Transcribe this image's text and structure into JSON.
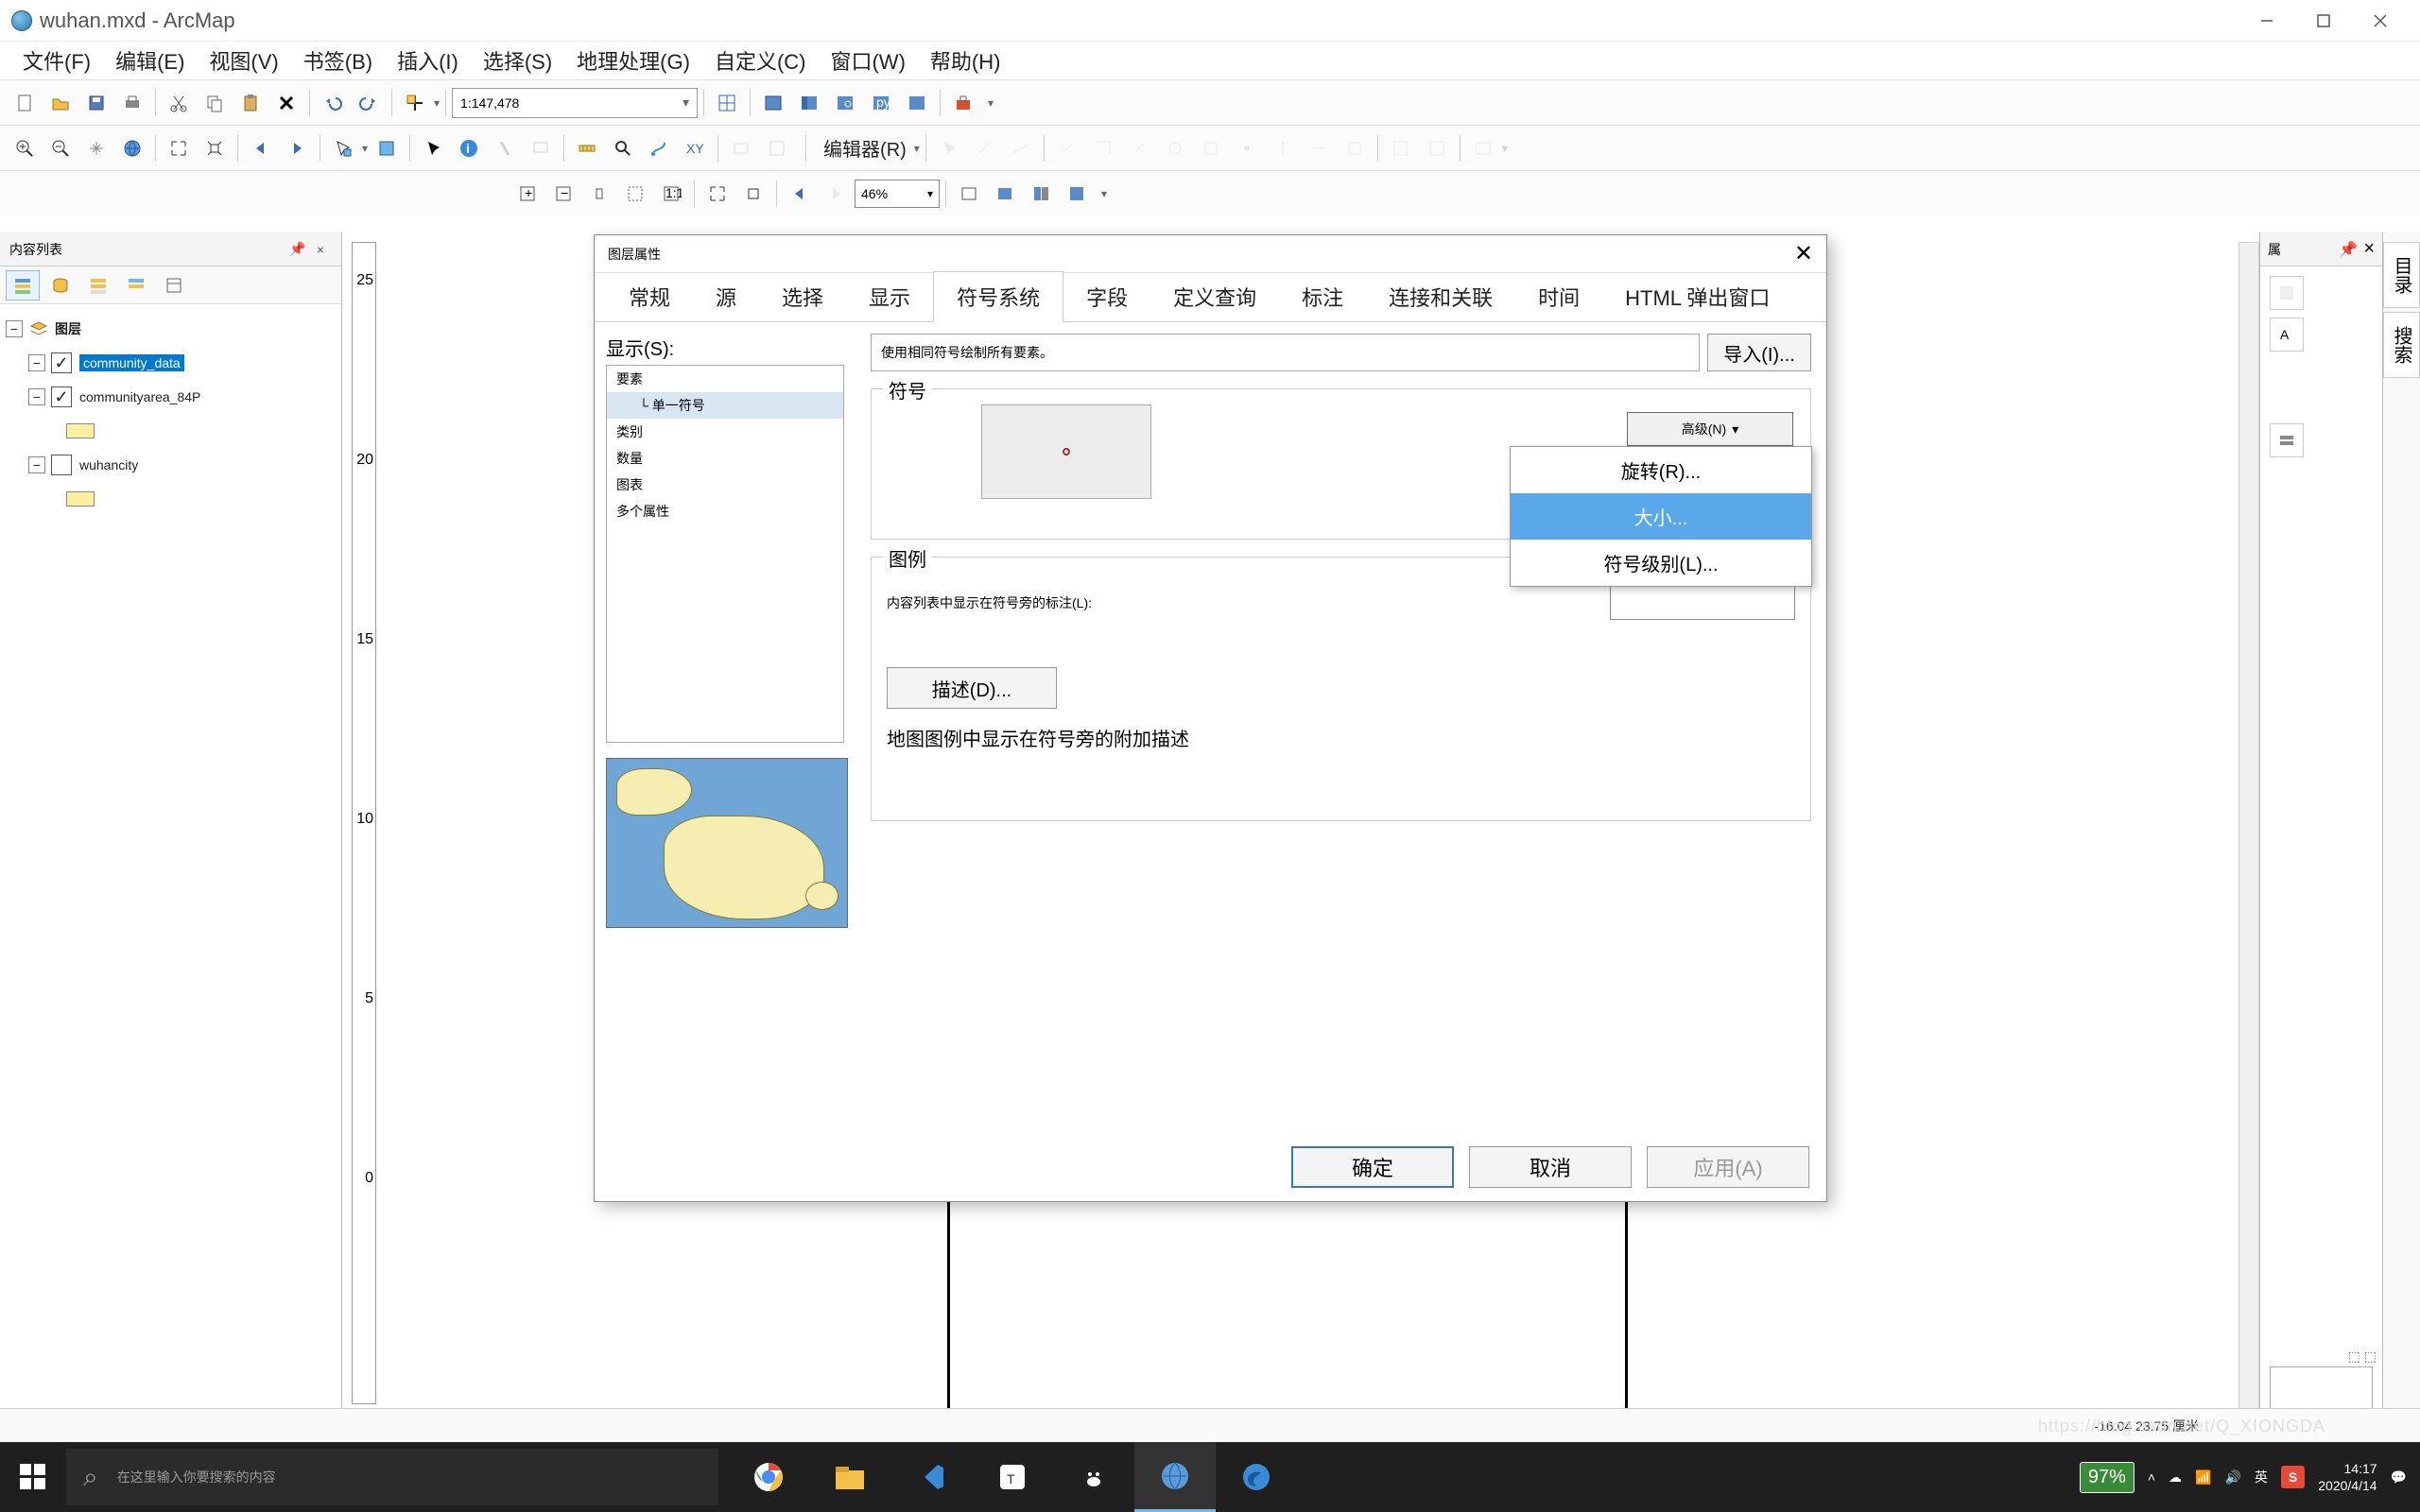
{
  "app": {
    "title": "wuhan.mxd - ArcMap"
  },
  "menus": [
    "文件(F)",
    "编辑(E)",
    "视图(V)",
    "书签(B)",
    "插入(I)",
    "选择(S)",
    "地理处理(G)",
    "自定义(C)",
    "窗口(W)",
    "帮助(H)"
  ],
  "toolbar": {
    "scale": "1:147,478",
    "editor_label": "编辑器(R)",
    "zoom_pct": "46%"
  },
  "toc": {
    "title": "内容列表",
    "root": "图层",
    "layers": [
      {
        "name": "community_data",
        "checked": true,
        "selected": true
      },
      {
        "name": "communityarea_84P",
        "checked": true,
        "swatch": "yellow"
      },
      {
        "name": "wuhancity",
        "checked": false,
        "swatch": "yellow"
      }
    ]
  },
  "right_panel": {
    "title": "属",
    "pin": "📌",
    "close": "×",
    "tab1": "目录",
    "tab2": "搜索"
  },
  "dialog": {
    "title": "图层属性",
    "tabs": [
      "常规",
      "源",
      "选择",
      "显示",
      "符号系统",
      "字段",
      "定义查询",
      "标注",
      "连接和关联",
      "时间",
      "HTML 弹出窗口"
    ],
    "active_tab": "符号系统",
    "show_label": "显示(S):",
    "show_items": [
      "要素",
      "类别",
      "数量",
      "图表",
      "多个属性"
    ],
    "show_sub": "单一符号",
    "desc_text": "使用相同符号绘制所有要素。",
    "import_btn": "导入(I)...",
    "group_symbol": "符号",
    "adv_btn": "高级(N)",
    "adv_menu": [
      "旋转(R)...",
      "大小...",
      "符号级别(L)..."
    ],
    "adv_hover_index": 1,
    "group_legend": "图例",
    "label_in_toc": "内容列表中显示在符号旁的标注(L):",
    "desc_btn": "描述(D)...",
    "desc_note": "地图图例中显示在符号旁的附加描述",
    "ok": "确定",
    "cancel": "取消",
    "apply": "应用(A)"
  },
  "status": {
    "coords": "-16.04  23.75 厘米"
  },
  "taskbar": {
    "search_placeholder": "在这里输入你要搜索的内容",
    "battery": "97%",
    "ime": "英",
    "time": "14:17",
    "date": "2020/4/14"
  },
  "watermark": "https://blog.csdn.net/Q_XIONGDA",
  "ruler_ticks": [
    "25",
    "20",
    "15",
    "10",
    "5",
    "0"
  ]
}
